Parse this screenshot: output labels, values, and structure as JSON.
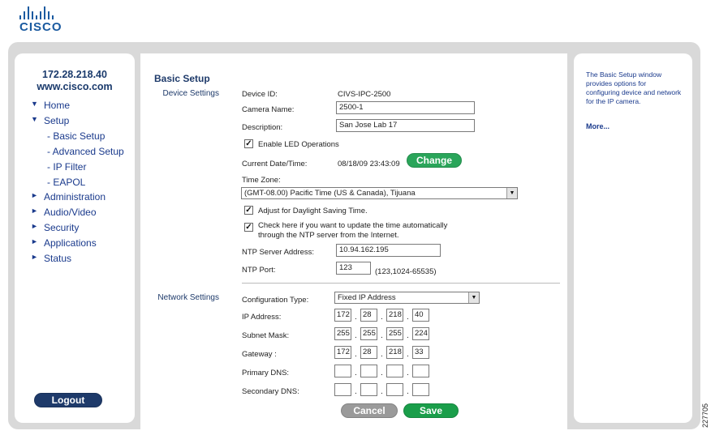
{
  "logo": {
    "text": "CISCO"
  },
  "sidebar": {
    "host_ip": "172.28.218.40",
    "host_domain": "www.cisco.com",
    "items": [
      {
        "label": "Home",
        "arrow": "▼"
      },
      {
        "label": "Setup",
        "arrow": "▼"
      },
      {
        "label": "- Basic Setup"
      },
      {
        "label": "- Advanced Setup"
      },
      {
        "label": "- IP Filter"
      },
      {
        "label": "- EAPOL"
      },
      {
        "label": "Administration",
        "arrow": "►"
      },
      {
        "label": "Audio/Video",
        "arrow": "►"
      },
      {
        "label": "Security",
        "arrow": "►"
      },
      {
        "label": "Applications",
        "arrow": "►"
      },
      {
        "label": "Status",
        "arrow": "►"
      }
    ],
    "logout_label": "Logout"
  },
  "main": {
    "title": "Basic Setup",
    "device_settings_label": "Device Settings",
    "network_settings_label": "Network Settings",
    "device": {
      "device_id_label": "Device ID:",
      "device_id_value": "CIVS-IPC-2500",
      "camera_name_label": "Camera Name:",
      "camera_name_value": "2500-1",
      "description_label": "Description:",
      "description_value": "San Jose Lab 17",
      "led_label": "Enable LED Operations",
      "date_time_label": "Current Date/Time:",
      "date_time_value": "08/18/09  23:43:09",
      "change_label": "Change",
      "time_zone_label": "Time Zone:",
      "time_zone_value": "(GMT-08.00) Pacific Time (US & Canada), Tijuana",
      "dst_label": "Adjust for Daylight Saving Time.",
      "ntp_auto_line1": "Check here if you want to update the time automatically",
      "ntp_auto_line2": "through the NTP server from the Internet.",
      "ntp_server_label": "NTP Server Address:",
      "ntp_server_value": "10.94.162.195",
      "ntp_port_label": "NTP Port:",
      "ntp_port_value": "123",
      "ntp_port_range": "(123,1024-65535)"
    },
    "network": {
      "config_type_label": "Configuration Type:",
      "config_type_value": "Fixed IP Address",
      "ip_label": "IP Address:",
      "ip": [
        "172",
        "28",
        "218",
        "40"
      ],
      "subnet_label": "Subnet Mask:",
      "subnet": [
        "255",
        "255",
        "255",
        "224"
      ],
      "gateway_label": "Gateway :",
      "gateway": [
        "172",
        "28",
        "218",
        "33"
      ],
      "primary_dns_label": "Primary DNS:",
      "primary_dns": [
        "",
        "",
        "",
        ""
      ],
      "secondary_dns_label": "Secondary DNS:",
      "secondary_dns": [
        "",
        "",
        "",
        ""
      ]
    },
    "cancel_label": "Cancel",
    "save_label": "Save"
  },
  "help": {
    "text": "The Basic Setup window provides options for configuring device and network for the IP camera.",
    "more_label": "More..."
  },
  "figure_id": "227705",
  "colors": {
    "navy": "#1e3a6a",
    "change_green": "#2aa55a",
    "save_green": "#1a9e4a",
    "cancel_gray": "#9a9a9a",
    "frame_gray": "#d9d9d9"
  }
}
